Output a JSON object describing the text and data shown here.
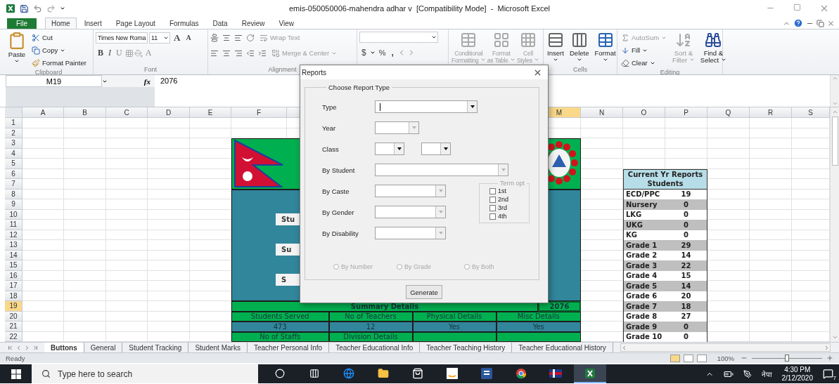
{
  "window": {
    "title": "emis-050050006-mahendra adhar v  [Compatibility Mode]  -  Microsoft Excel"
  },
  "ribbon_tabs": {
    "file": "File",
    "tabs": [
      {
        "label": "Home",
        "selected": true
      },
      {
        "label": "Insert",
        "selected": false
      },
      {
        "label": "Page Layout",
        "selected": false
      },
      {
        "label": "Formulas",
        "selected": false
      },
      {
        "label": "Data",
        "selected": false
      },
      {
        "label": "Review",
        "selected": false
      },
      {
        "label": "View",
        "selected": false
      }
    ]
  },
  "ribbon": {
    "clipboard": {
      "label": "Clipboard",
      "paste": "Paste",
      "cut": "Cut",
      "copy": "Copy",
      "format_painter": "Format Painter"
    },
    "font": {
      "label": "Font",
      "font_name": "Times New Roma",
      "font_size": "11",
      "grow": "A",
      "shrink": "A",
      "bold": "B",
      "italic": "I",
      "underline": "U",
      "font_color": "A"
    },
    "alignment": {
      "label": "Alignment",
      "wrap_text": {
        "label": "Wrap Text",
        "disabled": true
      },
      "merge_center": {
        "label": "Merge & Center",
        "disabled": true
      }
    },
    "number": {
      "currency": "$",
      "percent": "%",
      "comma": ","
    },
    "styles": {
      "items": [
        {
          "lines": [
            "Conditional",
            "Formatting"
          ],
          "disabled": true
        },
        {
          "lines": [
            "Format",
            "as Table"
          ],
          "disabled": true
        },
        {
          "lines": [
            "Cell",
            "Styles"
          ],
          "disabled": true
        }
      ]
    },
    "cells": {
      "label": "Cells",
      "items": [
        {
          "label": "Insert"
        },
        {
          "label": "Delete"
        },
        {
          "label": "Format"
        }
      ]
    },
    "editing": {
      "label": "Editing",
      "autosum": {
        "label": "AutoSum",
        "disabled": true
      },
      "fill": {
        "label": "Fill",
        "disabled": false
      },
      "clear": {
        "label": "Clear",
        "disabled": false
      },
      "sort_filter": {
        "lines": [
          "Sort &",
          "Filter"
        ],
        "disabled": true
      },
      "find_select": {
        "lines": [
          "Find &",
          "Select"
        ],
        "disabled": false
      }
    }
  },
  "formula_bar": {
    "name_box": "M19",
    "function_label": "fx",
    "value": "2076"
  },
  "sheet": {
    "columns": [
      {
        "label": "A",
        "selected": false
      },
      {
        "label": "B",
        "selected": false
      },
      {
        "label": "C",
        "selected": false
      },
      {
        "label": "D",
        "selected": false
      },
      {
        "label": "E",
        "selected": false
      },
      {
        "label": "F",
        "selected": false
      },
      {
        "label": "M",
        "selected": true
      },
      {
        "label": "N",
        "selected": false
      },
      {
        "label": "O",
        "selected": false
      },
      {
        "label": "P",
        "selected": false
      },
      {
        "label": "Q",
        "selected": false
      },
      {
        "label": "R",
        "selected": false
      },
      {
        "label": "S",
        "selected": false
      }
    ],
    "rows": [
      {
        "label": "1",
        "selected": false
      },
      {
        "label": "2",
        "selected": false
      },
      {
        "label": "3",
        "selected": false
      },
      {
        "label": "4",
        "selected": false
      },
      {
        "label": "5",
        "selected": false
      },
      {
        "label": "6",
        "selected": false
      },
      {
        "label": "7",
        "selected": false
      },
      {
        "label": "8",
        "selected": false
      },
      {
        "label": "9",
        "selected": false
      },
      {
        "label": "10",
        "selected": false
      },
      {
        "label": "11",
        "selected": false
      },
      {
        "label": "12",
        "selected": false
      },
      {
        "label": "13",
        "selected": false
      },
      {
        "label": "14",
        "selected": false
      },
      {
        "label": "15",
        "selected": false
      },
      {
        "label": "16",
        "selected": false
      },
      {
        "label": "17",
        "selected": false
      },
      {
        "label": "18",
        "selected": false
      },
      {
        "label": "19",
        "selected": true
      },
      {
        "label": "20",
        "selected": false
      },
      {
        "label": "21",
        "selected": false
      },
      {
        "label": "22",
        "selected": false
      }
    ],
    "dashboard": {
      "buttons": [
        "Stu",
        "Su",
        "S"
      ],
      "summary_title": "Summary Details",
      "year": "2076",
      "headers": [
        "Students Served",
        "No of Teachers",
        "Physical Details",
        "Misc Details"
      ],
      "values": [
        "473",
        "12",
        "Yes",
        "Yes"
      ],
      "next_headers": [
        "No of Staffs",
        "Division Details"
      ]
    },
    "student_report": {
      "title": "Current Yr Reports Students",
      "rows": [
        {
          "grade": "ECD/PPC",
          "count": "19"
        },
        {
          "grade": "Nursery",
          "count": "0"
        },
        {
          "grade": "LKG",
          "count": "0"
        },
        {
          "grade": "UKG",
          "count": "0"
        },
        {
          "grade": "KG",
          "count": "0"
        },
        {
          "grade": "Grade 1",
          "count": "29"
        },
        {
          "grade": "Grade 2",
          "count": "14"
        },
        {
          "grade": "Grade 3",
          "count": "22"
        },
        {
          "grade": "Grade 4",
          "count": "15"
        },
        {
          "grade": "Grade 5",
          "count": "14"
        },
        {
          "grade": "Grade 6",
          "count": "20"
        },
        {
          "grade": "Grade 7",
          "count": "18"
        },
        {
          "grade": "Grade 8",
          "count": "27"
        },
        {
          "grade": "Grade 9",
          "count": "0"
        },
        {
          "grade": "Grade 10",
          "count": "0"
        }
      ]
    }
  },
  "dialog": {
    "title": "Reports",
    "group_title": "Choose Report Type",
    "fields": [
      {
        "label": "Type",
        "dropdowns": [
          {
            "disabled": false,
            "focused": true
          }
        ]
      },
      {
        "label": "Year",
        "dropdowns": [
          {
            "disabled": true,
            "focused": false
          }
        ]
      },
      {
        "label": "Class",
        "dropdowns": [
          {
            "disabled": false,
            "focused": false
          },
          {
            "disabled": false,
            "focused": false
          }
        ]
      },
      {
        "label": "By Student",
        "dropdowns": [
          {
            "disabled": true,
            "focused": false
          }
        ]
      },
      {
        "label": "By Caste",
        "dropdowns": [
          {
            "disabled": true,
            "focused": false
          }
        ]
      },
      {
        "label": "By Gender",
        "dropdowns": [
          {
            "disabled": true,
            "focused": false
          }
        ]
      },
      {
        "label": "By Disability",
        "dropdowns": [
          {
            "disabled": true,
            "focused": false
          }
        ]
      }
    ],
    "term_options": {
      "title": "Term opt",
      "disabled": true,
      "items": [
        {
          "label": "1st",
          "checked": false
        },
        {
          "label": "2nd",
          "checked": false
        },
        {
          "label": "3rd",
          "checked": false
        },
        {
          "label": "4th",
          "checked": false
        }
      ]
    },
    "radios": [
      {
        "label": "By Number",
        "selected": false,
        "disabled": true
      },
      {
        "label": "By Grade",
        "selected": false,
        "disabled": true
      },
      {
        "label": "By Both",
        "selected": false,
        "disabled": true
      }
    ],
    "generate": "Generate"
  },
  "sheet_tabs": [
    {
      "label": "Buttons",
      "selected": true
    },
    {
      "label": "General",
      "selected": false
    },
    {
      "label": "Student Tracking",
      "selected": false
    },
    {
      "label": "Student Marks",
      "selected": false
    },
    {
      "label": "Teacher Personal Info",
      "selected": false
    },
    {
      "label": "Teacher Educational Info",
      "selected": false
    },
    {
      "label": "Teacher Teaching History",
      "selected": false
    },
    {
      "label": "Teacher Educational History",
      "selected": false
    }
  ],
  "status_bar": {
    "status": "Ready",
    "views": [
      {
        "selected": true
      },
      {
        "selected": false
      },
      {
        "selected": false
      }
    ],
    "zoom": "100%",
    "zoom_slider": {
      "level": 0.5
    }
  },
  "taskbar": {
    "search_placeholder": "Type here to search",
    "apps": [
      {
        "selected": false
      },
      {
        "selected": false
      },
      {
        "selected": false
      },
      {
        "selected": false
      },
      {
        "selected": false
      },
      {
        "selected": false
      },
      {
        "selected": false
      },
      {
        "selected": false
      },
      {
        "selected": false
      },
      {
        "selected": true
      }
    ],
    "language": "नेपा",
    "time": "4:30 PM",
    "date": "2/12/2020",
    "notifications": "7"
  }
}
